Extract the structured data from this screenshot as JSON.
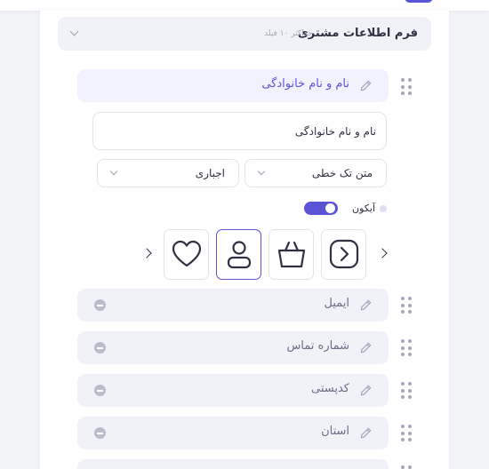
{
  "section": {
    "title": "فرم اطلاعات مشتری",
    "hint": "حداکثر ۱۰ فیلد"
  },
  "active_field": {
    "label": "نام و نام خانوادگی",
    "input_value": "نام و نام خانوادگی",
    "type_select": "متن تک خطی",
    "required_select": "اجباری",
    "icon_toggle_label": "آیکون",
    "icon_toggle_on": true,
    "icon_options": [
      "chevron-right-box-icon",
      "basket-icon",
      "user-icon",
      "heart-icon"
    ],
    "selected_icon": "user-icon"
  },
  "fields": [
    {
      "label": "ایمیل"
    },
    {
      "label": "شماره تماس"
    },
    {
      "label": "کدپستی"
    },
    {
      "label": "استان"
    }
  ],
  "colors": {
    "accent": "#5b53d6",
    "card_active": "#f1f2fd",
    "card": "#f1f2f7",
    "muted": "#a3a6bd"
  }
}
